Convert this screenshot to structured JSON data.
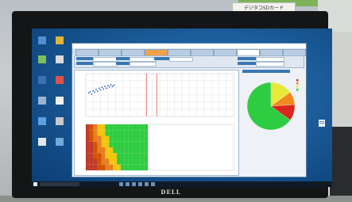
{
  "scene": {
    "sticker_text": "デジタコSDカード",
    "monitor_brand": "DELL"
  },
  "desktop": {
    "icons": [
      {
        "name": "desktop-icon-1",
        "label": ""
      },
      {
        "name": "desktop-icon-2",
        "label": ""
      },
      {
        "name": "desktop-icon-3",
        "label": ""
      },
      {
        "name": "desktop-icon-4",
        "label": ""
      },
      {
        "name": "desktop-icon-5",
        "label": ""
      },
      {
        "name": "desktop-icon-6",
        "label": ""
      },
      {
        "name": "desktop-icon-7",
        "label": ""
      },
      {
        "name": "desktop-icon-8",
        "label": ""
      },
      {
        "name": "desktop-icon-9",
        "label": ""
      },
      {
        "name": "desktop-icon-10",
        "label": ""
      },
      {
        "name": "desktop-icon-11",
        "label": ""
      },
      {
        "name": "desktop-icon-12",
        "label": ""
      }
    ]
  },
  "taskbar": {
    "search_placeholder": "",
    "tray_time": ""
  },
  "app": {
    "title": "",
    "tabs": [
      "",
      "",
      "",
      "",
      "",
      "",
      "",
      "",
      "",
      ""
    ],
    "active_tab_index": 3,
    "selected_tab_index": 7,
    "pie_title": ""
  },
  "colors": {
    "accent_orange": "#f3a24a",
    "header_blue": "#3a76b3",
    "pie_green": "#2ecc40",
    "pie_yellow": "#e8e83a",
    "pie_orange": "#f08a1d",
    "pie_red": "#d9261c"
  },
  "chart_data": [
    {
      "type": "scatter",
      "title": "",
      "xlabel": "",
      "ylabel": "",
      "series": [
        {
          "values": [
            [
              2,
              55
            ],
            [
              3,
              58
            ],
            [
              4,
              52
            ],
            [
              5,
              60
            ],
            [
              6,
              57
            ],
            [
              7,
              63
            ],
            [
              8,
              59
            ],
            [
              9,
              66
            ],
            [
              10,
              62
            ],
            [
              11,
              68
            ],
            [
              12,
              64
            ],
            [
              13,
              70
            ],
            [
              14,
              66
            ],
            [
              15,
              72
            ],
            [
              16,
              69
            ],
            [
              17,
              74
            ],
            [
              18,
              70
            ],
            [
              19,
              73
            ]
          ]
        }
      ],
      "vlines": [
        41,
        48
      ],
      "grid": true
    },
    {
      "type": "pie",
      "title": "",
      "slices": [
        {
          "label": "",
          "value": 65,
          "color": "#2ecc40"
        },
        {
          "label": "",
          "value": 15,
          "color": "#e8e83a"
        },
        {
          "label": "",
          "value": 9,
          "color": "#f08a1d"
        },
        {
          "label": "",
          "value": 11,
          "color": "#d9261c"
        }
      ]
    },
    {
      "type": "heatmap",
      "title": "",
      "columns": 16,
      "rows": 8,
      "cells": [
        [
          "#c0392b",
          "#d35400",
          "#e67e22",
          "#f1c40f",
          "#f1c40f",
          "#2ecc40",
          "#2ecc40",
          "#2ecc40",
          "#2ecc40",
          "#2ecc40",
          "#2ecc40",
          "#2ecc40",
          "#2ecc40",
          "#2ecc40",
          "#2ecc40",
          "#2ecc40"
        ],
        [
          "#c0392b",
          "#d35400",
          "#e67e22",
          "#f1c40f",
          "#f1c40f",
          "#2ecc40",
          "#2ecc40",
          "#2ecc40",
          "#2ecc40",
          "#2ecc40",
          "#2ecc40",
          "#2ecc40",
          "#2ecc40",
          "#2ecc40",
          "#2ecc40",
          "#2ecc40"
        ],
        [
          "#c0392b",
          "#d35400",
          "#e67e22",
          "#e67e22",
          "#f1c40f",
          "#f1c40f",
          "#2ecc40",
          "#2ecc40",
          "#2ecc40",
          "#2ecc40",
          "#2ecc40",
          "#2ecc40",
          "#2ecc40",
          "#2ecc40",
          "#2ecc40",
          "#2ecc40"
        ],
        [
          "#c0392b",
          "#c0392b",
          "#d35400",
          "#e67e22",
          "#f1c40f",
          "#f1c40f",
          "#2ecc40",
          "#2ecc40",
          "#2ecc40",
          "#2ecc40",
          "#2ecc40",
          "#2ecc40",
          "#2ecc40",
          "#2ecc40",
          "#2ecc40",
          "#2ecc40"
        ],
        [
          "#c0392b",
          "#c0392b",
          "#d35400",
          "#e67e22",
          "#e67e22",
          "#f1c40f",
          "#f1c40f",
          "#2ecc40",
          "#2ecc40",
          "#2ecc40",
          "#2ecc40",
          "#2ecc40",
          "#2ecc40",
          "#2ecc40",
          "#2ecc40",
          "#2ecc40"
        ],
        [
          "#c0392b",
          "#c0392b",
          "#d35400",
          "#d35400",
          "#e67e22",
          "#f1c40f",
          "#f1c40f",
          "#f1c40f",
          "#2ecc40",
          "#2ecc40",
          "#2ecc40",
          "#2ecc40",
          "#2ecc40",
          "#2ecc40",
          "#2ecc40",
          "#2ecc40"
        ],
        [
          "#c0392b",
          "#c0392b",
          "#c0392b",
          "#d35400",
          "#e67e22",
          "#e67e22",
          "#f1c40f",
          "#f1c40f",
          "#2ecc40",
          "#2ecc40",
          "#2ecc40",
          "#2ecc40",
          "#2ecc40",
          "#2ecc40",
          "#2ecc40",
          "#2ecc40"
        ],
        [
          "#c0392b",
          "#c0392b",
          "#c0392b",
          "#d35400",
          "#d35400",
          "#e67e22",
          "#e67e22",
          "#f1c40f",
          "#f1c40f",
          "#2ecc40",
          "#2ecc40",
          "#2ecc40",
          "#2ecc40",
          "#2ecc40",
          "#2ecc40",
          "#2ecc40"
        ]
      ]
    }
  ]
}
